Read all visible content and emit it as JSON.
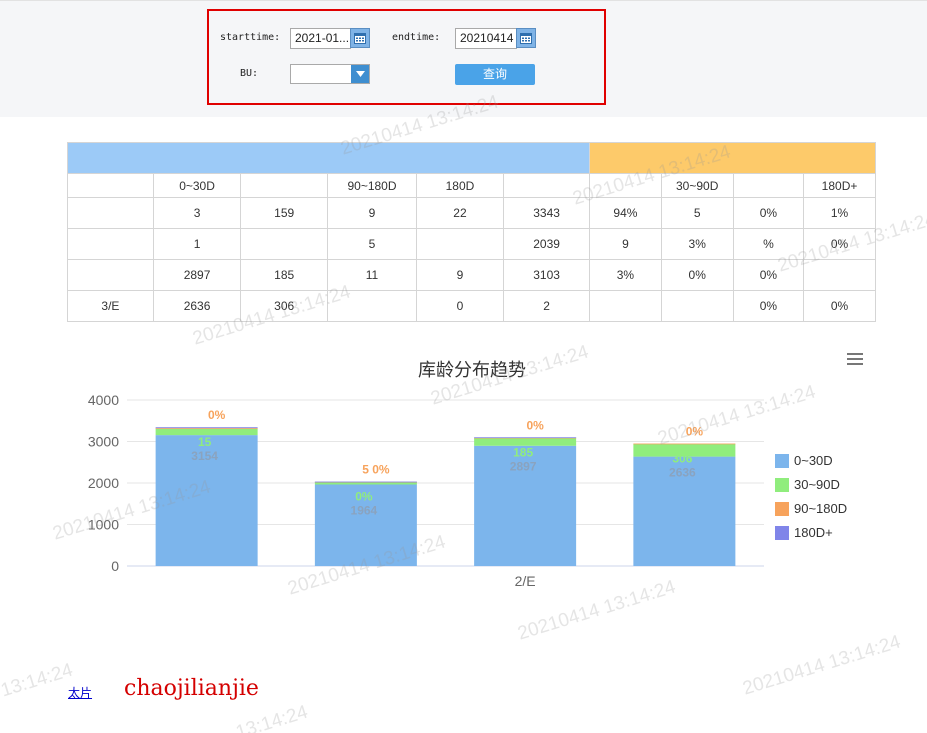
{
  "filters": {
    "starttime_label": "starttime:",
    "starttime_value": "2021-01...",
    "endtime_label": "endtime:",
    "endtime_value": "20210414",
    "bu_label": "BU:",
    "bu_value": "",
    "query_button": "查询"
  },
  "table": {
    "group_a": "",
    "group_b": "",
    "headers": [
      "",
      "0~30D",
      "",
      "90~180D",
      "180D",
      "",
      "",
      "30~90D",
      "",
      "180D+"
    ],
    "rows": [
      [
        "",
        "3",
        "159",
        "9",
        "22",
        "3343",
        "94%",
        "5",
        "0%",
        "1%"
      ],
      [
        "",
        "1",
        "",
        "5",
        "",
        "2039",
        "9",
        "3%",
        "%",
        "0%"
      ],
      [
        "",
        "2897",
        "185",
        "11",
        "9",
        "3103",
        "3%",
        "0%",
        "0%",
        ""
      ],
      [
        "3/E",
        "2636",
        "306",
        "",
        "0",
        "2",
        "",
        "",
        "0%",
        "0%"
      ]
    ]
  },
  "chart_data": {
    "type": "bar",
    "title": "库龄分布趋势",
    "categories": [
      "",
      "",
      "2/E",
      ""
    ],
    "ylim": [
      0,
      4000
    ],
    "yticks": [
      "0",
      "1000",
      "2000",
      "3000",
      "4000"
    ],
    "series": [
      {
        "name": "0~30D",
        "color": "#7cb5ec",
        "values": [
          3154,
          1964,
          2897,
          2636
        ]
      },
      {
        "name": "30~90D",
        "color": "#90ed7d",
        "values": [
          159,
          60,
          185,
          306
        ]
      },
      {
        "name": "90~180D",
        "color": "#f7a35c",
        "values": [
          9,
          5,
          11,
          9
        ]
      },
      {
        "name": "180D+",
        "color": "#8085e9",
        "values": [
          22,
          5,
          9,
          0
        ]
      }
    ],
    "data_labels": [
      {
        "top": "0%",
        "mid": "15",
        "low": "3154"
      },
      {
        "top": "5  0%",
        "mid": "0%",
        "low": "1964"
      },
      {
        "top": "0%",
        "mid": "185",
        "low": "2897"
      },
      {
        "top": "0%",
        "mid": "306",
        "low": "2636"
      }
    ],
    "legend": [
      "0~30D",
      "30~90D",
      "90~180D",
      "180D+"
    ],
    "legend_position": "right",
    "grid": true
  },
  "footer": {
    "link_text": "太片",
    "red_text": "chaojilianjie"
  },
  "watermark_text": "20210414 13:14:24",
  "watermark_time": "13:14:24"
}
